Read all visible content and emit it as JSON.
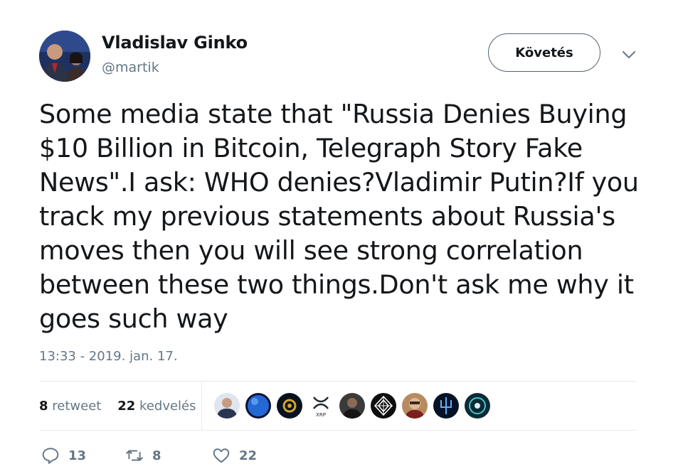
{
  "author": {
    "name": "Vladislav Ginko",
    "handle": "@martik"
  },
  "follow_button_label": "Követés",
  "tweet": {
    "text": "Some media state that \"Russia Denies Buying $10 Billion in Bitcoin, Telegraph Story Fake News\".I ask: WHO denies?Vladimir Putin?If you track my previous statements about Russia's moves then you will see strong correlation between these two things.Don't ask me why it goes such way",
    "timestamp": "13:33 - 2019. jan. 17."
  },
  "stats": {
    "retweet_count": "8",
    "retweet_label": "retweet",
    "like_count": "22",
    "like_label": "kedvelés"
  },
  "likers": [
    {
      "icon": "man-in-suit-avatar",
      "color": "#3a4a6a"
    },
    {
      "icon": "blue-planet-avatar",
      "color": "#1f5fbf"
    },
    {
      "icon": "gold-coin-avatar",
      "color": "#0c1a2a"
    },
    {
      "icon": "xrp-logo-avatar",
      "color": "#ffffff",
      "text": "XRP"
    },
    {
      "icon": "dark-portrait-avatar",
      "color": "#2a2a2a"
    },
    {
      "icon": "white-geometric-avatar",
      "color": "#111111"
    },
    {
      "icon": "man-portrait-avatar",
      "color": "#8a5a3a"
    },
    {
      "icon": "blue-trident-avatar",
      "color": "#0a1a3a"
    },
    {
      "icon": "teal-ornament-avatar",
      "color": "#0f3a4a"
    }
  ],
  "actions": {
    "reply_count": "13",
    "retweet_count": "8",
    "like_count": "22"
  }
}
